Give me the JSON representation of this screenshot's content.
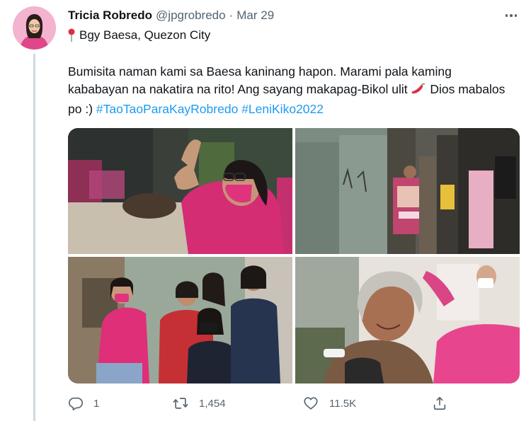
{
  "tweet": {
    "display_name": "Tricia Robredo",
    "handle": "@jpgrobredo",
    "separator": "·",
    "date": "Mar 29",
    "location": "Bgy Baesa, Quezon City",
    "text_part1": "Bumisita naman kami sa Baesa kaninang hapon. Marami pala kaming kababayan na nakatira na rito! Ang sayang makapag-Bikol ulit ",
    "text_part2": " Dios mabalos po :) ",
    "hashtag1": "#TaoTaoParaKayRobredo",
    "hashtag2": "#LeniKiko2022"
  },
  "stats": {
    "replies": "1",
    "retweets": "1,454",
    "likes": "11.5K"
  },
  "icons": {
    "more": "more-horizontal-icon",
    "pin": "round-pushpin-icon",
    "chili": "hot-pepper-emoji",
    "reply": "reply-icon",
    "retweet": "retweet-icon",
    "like": "heart-icon",
    "share": "share-icon"
  },
  "colors": {
    "link": "#1d9bf0",
    "text": "#0f1419",
    "muted": "#536471",
    "shirt_pink": "#d6336c"
  }
}
